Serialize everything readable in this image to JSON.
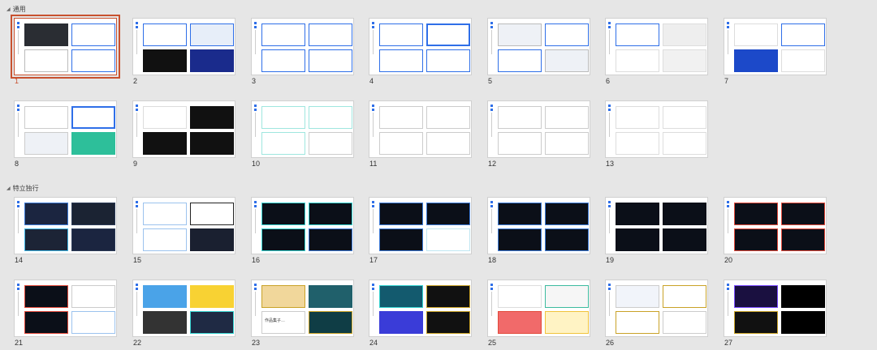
{
  "sections": [
    {
      "name": "通用",
      "thumbs": [
        "1",
        "2",
        "3",
        "4",
        "5",
        "6",
        "7",
        "8",
        "9",
        "10",
        "11",
        "12",
        "13"
      ],
      "selected": "1"
    },
    {
      "name": "特立独行",
      "thumbs": [
        "14",
        "15",
        "16",
        "17",
        "18",
        "19",
        "20",
        "21",
        "22",
        "23",
        "24",
        "25",
        "26",
        "27"
      ]
    }
  ],
  "icons": {
    "collapse": "triangle-collapse-icon"
  },
  "colors": {
    "accent": "#c8512f",
    "blue": "#2f6fe8",
    "cyan": "#35d3d0",
    "dark": "#15181f",
    "gold": "#c9a227",
    "red": "#e24a3b"
  },
  "slide_texts": {
    "t23_caption": "作品集子…"
  }
}
